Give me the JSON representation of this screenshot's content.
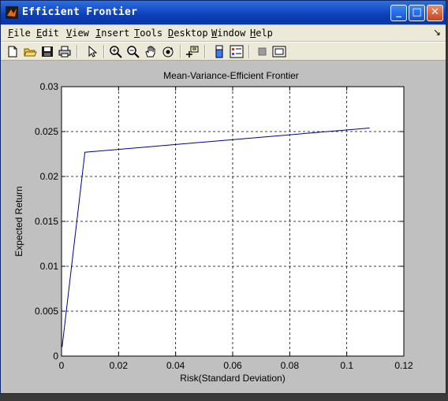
{
  "window": {
    "title": "Efficient Frontier"
  },
  "menu": [
    "File",
    "Edit",
    "View",
    "Insert",
    "Tools",
    "Desktop",
    "Window",
    "Help"
  ],
  "toolbar": [
    "new-file-icon",
    "open-folder-icon",
    "save-icon",
    "print-icon",
    "pointer-icon",
    "zoom-in-icon",
    "zoom-out-icon",
    "pan-hand-icon",
    "rotate-3d-icon",
    "data-cursor-icon",
    "colorbar-icon",
    "legend-icon",
    "hide-plot-tools-icon",
    "show-plot-tools-icon"
  ],
  "chart_data": {
    "type": "line",
    "title": "Mean-Variance-Efficient Frontier",
    "xlabel": "Risk(Standard Deviation)",
    "ylabel": "Expected Return",
    "xlim": [
      0,
      0.12
    ],
    "ylim": [
      0,
      0.03
    ],
    "xticks": [
      "0",
      "0.02",
      "0.04",
      "0.06",
      "0.08",
      "0.1",
      "0.12"
    ],
    "yticks": [
      "0",
      "0.005",
      "0.01",
      "0.015",
      "0.02",
      "0.025",
      "0.03"
    ],
    "grid": true,
    "series": [
      {
        "color": "#00008b",
        "x": [
          0.0002,
          0.0082,
          0.108
        ],
        "y": [
          0.001,
          0.0227,
          0.0254
        ]
      }
    ]
  }
}
